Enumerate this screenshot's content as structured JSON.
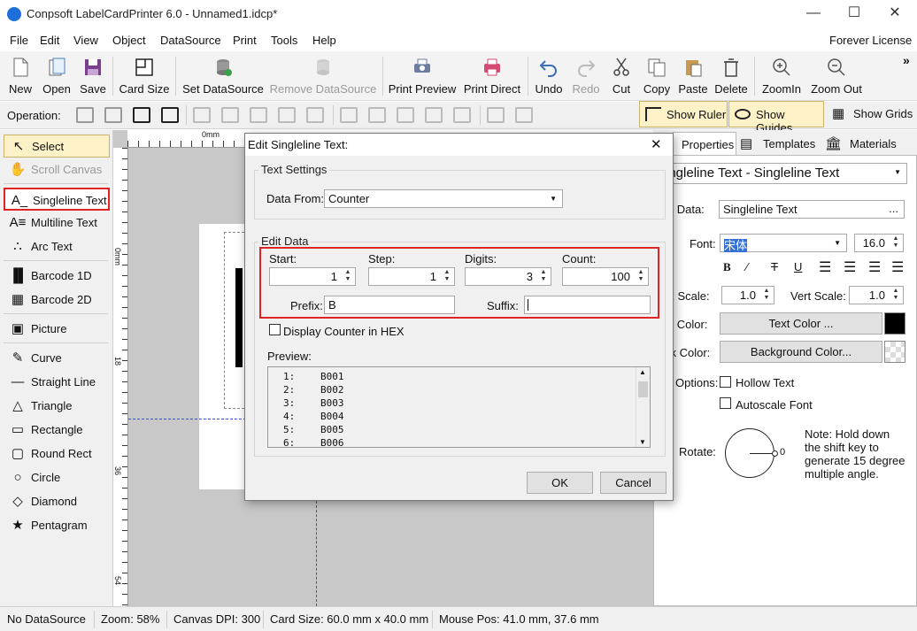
{
  "window": {
    "title": "Conpsoft LabelCardPrinter 6.0 - Unnamed1.idcp*",
    "min": "—",
    "max": "☐",
    "close": "✕"
  },
  "menu": [
    "File",
    "Edit",
    "View",
    "Object",
    "DataSource",
    "Print",
    "Tools",
    "Help"
  ],
  "license": "Forever License",
  "toolbar": [
    {
      "label": "New",
      "icon": "new-file-icon"
    },
    {
      "label": "Open",
      "icon": "open-icon"
    },
    {
      "label": "Save",
      "icon": "save-icon"
    },
    {
      "label": "Card Size",
      "icon": "card-size-icon"
    },
    {
      "label": "Set DataSource",
      "icon": "database-icon"
    },
    {
      "label": "Remove DataSource",
      "icon": "remove-database-icon"
    },
    {
      "label": "Print Preview",
      "icon": "print-preview-icon"
    },
    {
      "label": "Print Direct",
      "icon": "printer-icon"
    },
    {
      "label": "Undo",
      "icon": "undo-icon"
    },
    {
      "label": "Redo",
      "icon": "redo-icon"
    },
    {
      "label": "Cut",
      "icon": "scissors-icon"
    },
    {
      "label": "Copy",
      "icon": "copy-icon"
    },
    {
      "label": "Paste",
      "icon": "paste-icon"
    },
    {
      "label": "Delete",
      "icon": "trash-icon"
    },
    {
      "label": "ZoomIn",
      "icon": "zoom-in-icon"
    },
    {
      "label": "Zoom Out",
      "icon": "zoom-out-icon"
    }
  ],
  "more": "»",
  "operation_label": "Operation:",
  "view_toggles": [
    "Show Ruler",
    "Show Guides",
    "Show Grids"
  ],
  "tools": [
    {
      "label": "Select",
      "glyph": "↖"
    },
    {
      "label": "Scroll Canvas",
      "glyph": "✋"
    },
    {
      "label": "Singleline Text",
      "glyph": "A_"
    },
    {
      "label": "Multiline Text",
      "glyph": "A≡"
    },
    {
      "label": "Arc Text",
      "glyph": "∴"
    },
    {
      "label": "Barcode 1D",
      "glyph": "▐▌"
    },
    {
      "label": "Barcode 2D",
      "glyph": "▦"
    },
    {
      "label": "Picture",
      "glyph": "▣"
    },
    {
      "label": "Curve",
      "glyph": "✎"
    },
    {
      "label": "Straight Line",
      "glyph": "—"
    },
    {
      "label": "Triangle",
      "glyph": "△"
    },
    {
      "label": "Rectangle",
      "glyph": "▭"
    },
    {
      "label": "Round Rect",
      "glyph": "▢"
    },
    {
      "label": "Circle",
      "glyph": "○"
    },
    {
      "label": "Diamond",
      "glyph": "◇"
    },
    {
      "label": "Pentagram",
      "glyph": "★"
    }
  ],
  "ruler": {
    "h0": "0mm",
    "v": [
      "0mm",
      "18",
      "36",
      "54"
    ]
  },
  "right_tabs": [
    "Properties",
    "Templates",
    "Materials"
  ],
  "props": {
    "object_type": "ingleline Text - Singleline Text",
    "text_data_label": "xt Data:",
    "text_data_value": "Singleline Text",
    "text_data_btn": "...",
    "font_label": "Font:",
    "font_value": "宋体",
    "font_size": "16.0",
    "bold": "B",
    "italic": "∕",
    "strike": "T",
    "underline": "U",
    "horz_label": "rz Scale:",
    "horz_value": "1.0",
    "vert_label": "Vert Scale:",
    "vert_value": "1.0",
    "text_color_label": "xt Color:",
    "text_color_btn": "Text Color ...",
    "text_color": "#000000",
    "back_color_label": "ck Color:",
    "back_color_btn": "Background Color...",
    "options_label": "Options:",
    "hollow": "Hollow Text",
    "autoscale": "Autoscale Font",
    "rotate_label": "Rotate:",
    "rotate_value": "0",
    "note": "Note: Hold down the shift key to generate 15 degree multiple angle."
  },
  "status": [
    "No DataSource",
    "Zoom: 58%",
    "Canvas DPI: 300",
    "Card Size: 60.0 mm x 40.0 mm",
    "Mouse Pos: 41.0 mm, 37.6 mm"
  ],
  "dialog": {
    "title": "Edit Singleline Text:",
    "close": "✕",
    "text_settings": "Text Settings",
    "data_from_label": "Data From:",
    "data_from_value": "Counter",
    "edit_data": "Edit Data",
    "start_label": "Start:",
    "start": "1",
    "step_label": "Step:",
    "step": "1",
    "digits_label": "Digits:",
    "digits": "3",
    "count_label": "Count:",
    "count": "100",
    "prefix_label": "Prefix:",
    "prefix": "B",
    "suffix_label": "Suffix:",
    "suffix": "",
    "hex_label": "Display Counter in HEX",
    "preview_label": "Preview:",
    "preview": [
      {
        "n": "1:",
        "v": "B001"
      },
      {
        "n": "2:",
        "v": "B002"
      },
      {
        "n": "3:",
        "v": "B003"
      },
      {
        "n": "4:",
        "v": "B004"
      },
      {
        "n": "5:",
        "v": "B005"
      },
      {
        "n": "6:",
        "v": "B006"
      }
    ],
    "ok": "OK",
    "cancel": "Cancel"
  }
}
